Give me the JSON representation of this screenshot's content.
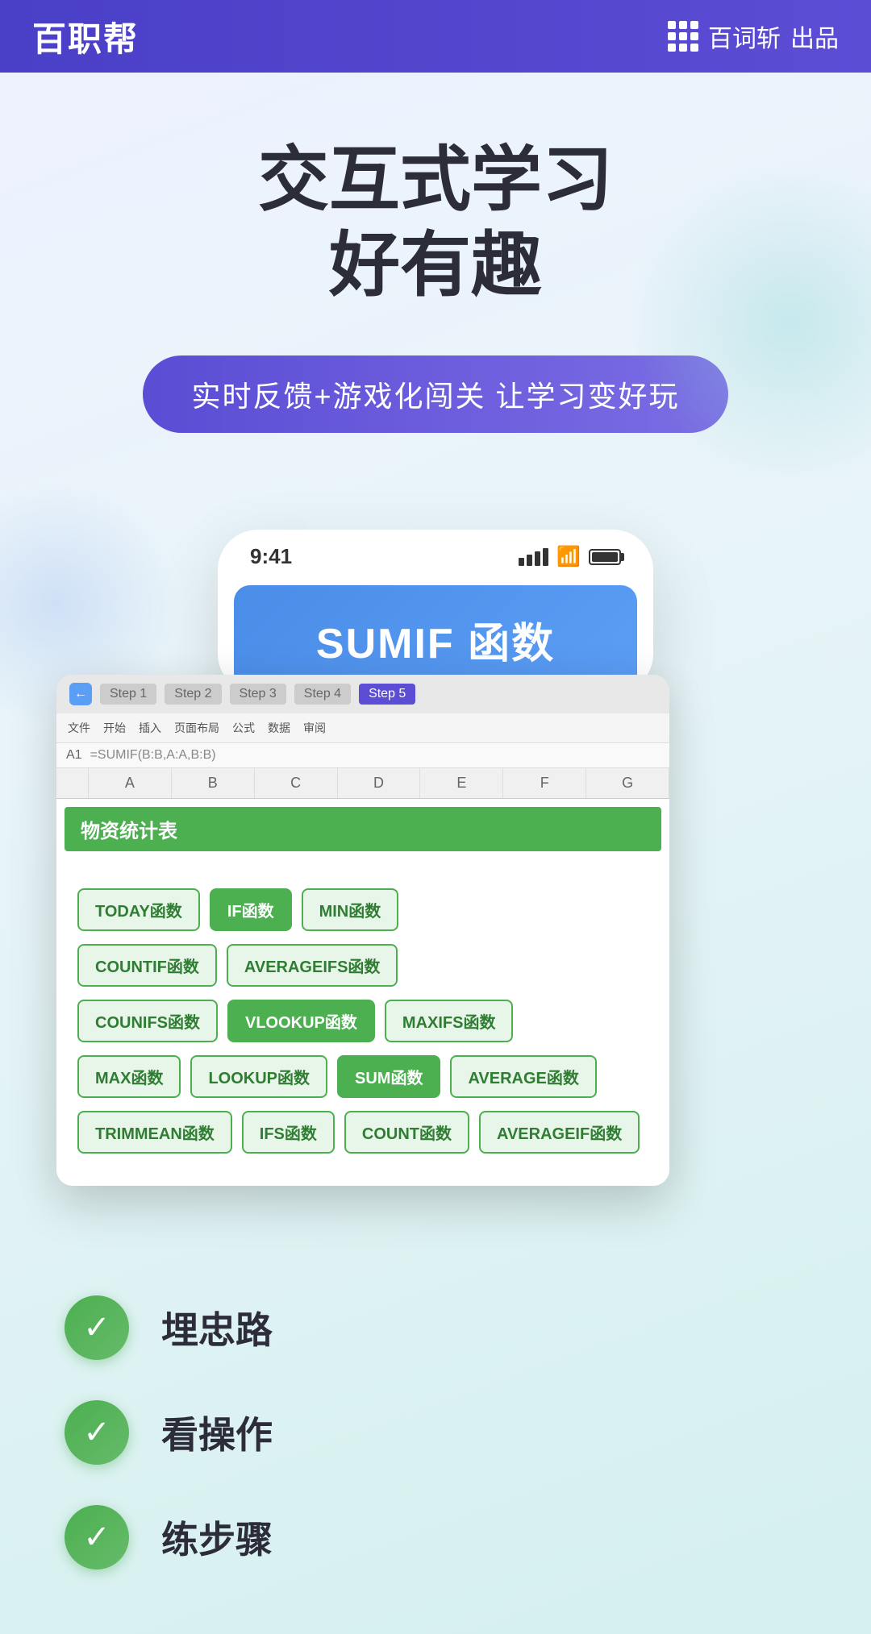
{
  "header": {
    "logo": "百职帮",
    "brand_icon_label": "百词斩出品",
    "brand_text": "百词斩",
    "brand_suffix": "出品"
  },
  "hero": {
    "title_line1": "交互式学习",
    "title_line2": "好有趣",
    "badge_text": "实时反馈+游戏化闯关  让学习变好玩"
  },
  "phone": {
    "time": "9:41",
    "sumif_title": "SUMIF 函数"
  },
  "spreadsheet": {
    "steps": [
      "Step 1",
      "Step 2",
      "Step 3",
      "Step 4",
      "Step 5"
    ],
    "active_step": 4,
    "sheet_title": "物资统计表",
    "functions": [
      {
        "label": "TODAY函数",
        "filled": false
      },
      {
        "label": "IF函数",
        "filled": true
      },
      {
        "label": "MIN函数",
        "filled": false
      },
      {
        "label": "COUNTIF函数",
        "filled": false
      },
      {
        "label": "AVERAGEIFS函数",
        "filled": false
      },
      {
        "label": "COUNIFS函数",
        "filled": false
      },
      {
        "label": "VLOOKUP函数",
        "filled": true
      },
      {
        "label": "MAXIFS函数",
        "filled": false
      },
      {
        "label": "MAX函数",
        "filled": false
      },
      {
        "label": "LOOKUP函数",
        "filled": false
      },
      {
        "label": "SUM函数",
        "filled": true
      },
      {
        "label": "AVERAGE函数",
        "filled": false
      },
      {
        "label": "TRIMMEAN函数",
        "filled": false
      },
      {
        "label": "IFS函数",
        "filled": false
      },
      {
        "label": "COUNT函数",
        "filled": false
      },
      {
        "label": "AVERAGEIF函数",
        "filled": false
      }
    ]
  },
  "checklist": [
    {
      "label": "埋忠路"
    },
    {
      "label": "看操作"
    },
    {
      "label": "练步骤"
    }
  ],
  "colors": {
    "header_bg": "#4a3fc7",
    "badge_bg": "#5b4dd4",
    "check_green": "#4caf50",
    "blue_card": "#4a8de8"
  }
}
